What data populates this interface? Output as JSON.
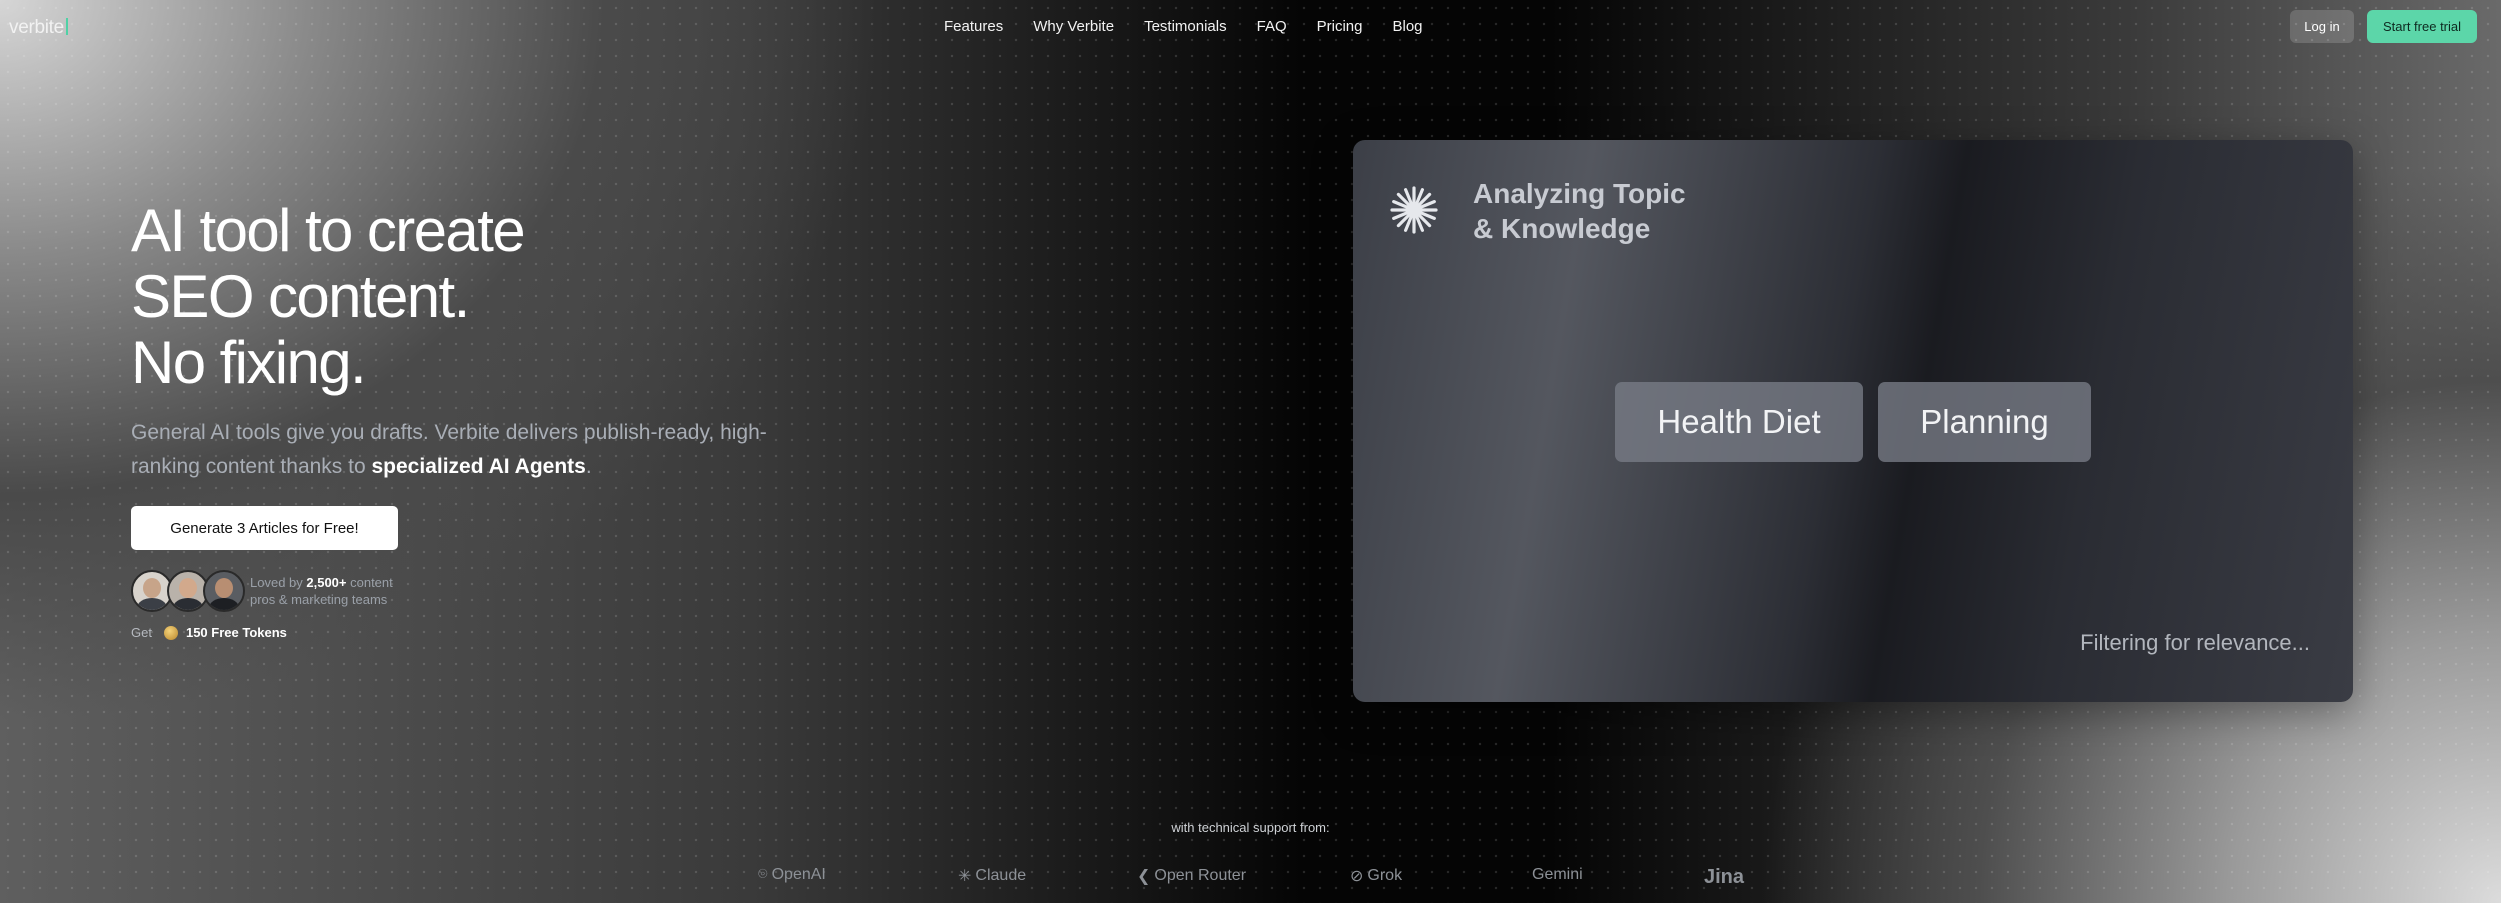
{
  "nav": {
    "logo": "verbite",
    "links": [
      "Features",
      "Why Verbite",
      "Testimonials",
      "FAQ",
      "Pricing",
      "Blog"
    ],
    "login_label": "Log in",
    "trial_label": "Start free trial",
    "accent_color": "#5cd6a9"
  },
  "hero": {
    "title_lines": [
      "AI tool to create",
      "SEO content.",
      "No fixing."
    ],
    "subtitle_before": "General AI tools give you drafts. Verbite delivers publish-ready, high-ranking content thanks to ",
    "subtitle_strong": "specialized AI Agents",
    "subtitle_after": ".",
    "cta_label": "Generate 3 Articles for Free!",
    "loved_prefix": "Loved by ",
    "loved_count": "2,500+",
    "loved_suffix": " content pros & marketing teams",
    "tokens_prefix": "Get",
    "tokens_label": "150 Free Tokens"
  },
  "panel": {
    "title_line1": "Analyzing Topic",
    "title_line2": "& Knowledge",
    "chips": [
      "Health Diet",
      "Planning"
    ],
    "status": "Filtering for relevance..."
  },
  "support": {
    "label": "with technical support from:",
    "brands": [
      "OpenAI",
      "Claude",
      "Open Router",
      "Grok",
      "Gemini",
      "Jina"
    ]
  }
}
